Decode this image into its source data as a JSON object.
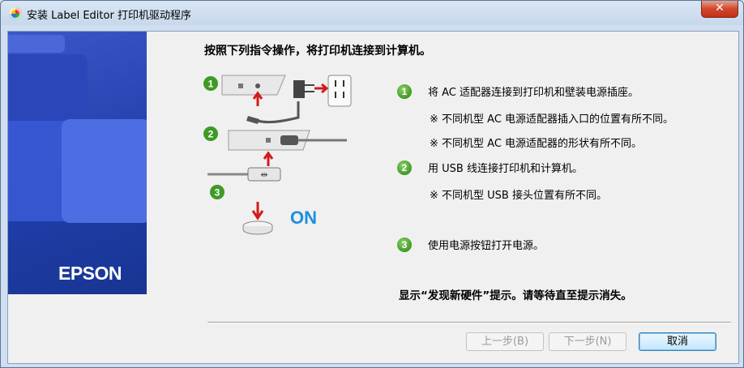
{
  "window": {
    "title": "安装 Label Editor 打印机驱动程序",
    "close_label": "✕"
  },
  "banner": {
    "brand": "EPSON",
    "brand_color": "#1f3da8"
  },
  "heading": "按照下列指令操作，将打印机连接到计算机。",
  "illustration": {
    "step_numbers": [
      "1",
      "2",
      "3"
    ],
    "on_label": "ON",
    "accent_red": "#d21b1b",
    "accent_blue": "#1a8fe0"
  },
  "steps": [
    {
      "number": "1",
      "text": "将 AC 适配器连接到打印机和壁装电源插座。",
      "notes": [
        "※ 不同机型 AC 电源适配器插入口的位置有所不同。",
        "※ 不同机型 AC 电源适配器的形状有所不同。"
      ]
    },
    {
      "number": "2",
      "text": "用 USB 线连接打印机和计算机。",
      "notes": [
        "※ 不同机型 USB 接头位置有所不同。"
      ]
    },
    {
      "number": "3",
      "text": "使用电源按钮打开电源。",
      "notes": []
    }
  ],
  "footer_message": "显示“发现新硬件”提示。请等待直至提示消失。",
  "buttons": {
    "back": "上一步(B)",
    "next": "下一步(N)",
    "cancel": "取消"
  }
}
